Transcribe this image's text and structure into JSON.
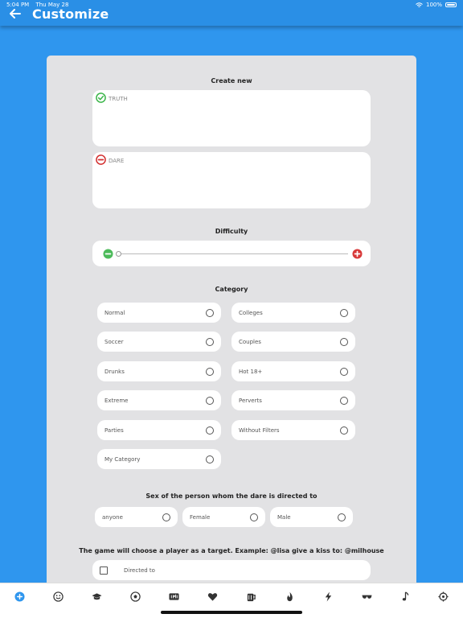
{
  "status_bar": {
    "time": "5:04 PM",
    "date": "Thu May 28",
    "battery": "100%"
  },
  "header": {
    "title": "Customize"
  },
  "create_new": {
    "title": "Create new",
    "truth_label": "TRUTH",
    "dare_label": "DARE"
  },
  "difficulty": {
    "title": "Difficulty",
    "value": 0
  },
  "category": {
    "title": "Category",
    "items": [
      "Normal",
      "Colleges",
      "Soccer",
      "Couples",
      "Drunks",
      "Hot 18+",
      "Extreme",
      "Perverts",
      "Parties",
      "Without Filters",
      "My Category"
    ]
  },
  "sex": {
    "title": "Sex of the person whom the dare is directed to",
    "items": [
      "anyone",
      "Female",
      "Male"
    ]
  },
  "target": {
    "title": "The game will choose a player as a target. Example: @lisa give a kiss to: @milhouse",
    "checkbox_label": "Directed to"
  },
  "tabbar": {
    "icons": [
      "plus-circle-icon",
      "smile-icon",
      "graduation-cap-icon",
      "soccer-ball-icon",
      "18-plus-icon",
      "heart-icon",
      "beer-mug-icon",
      "flame-icon",
      "lightning-icon",
      "glasses-icon",
      "music-note-icon",
      "crosshair-icon"
    ]
  },
  "colors": {
    "primary": "#2F96EE",
    "header": "#2A8FE6",
    "card": "#E2E2E4",
    "truth_green": "#3CB54A",
    "dare_red": "#D32F2F",
    "active_tab": "#2F96EE"
  }
}
